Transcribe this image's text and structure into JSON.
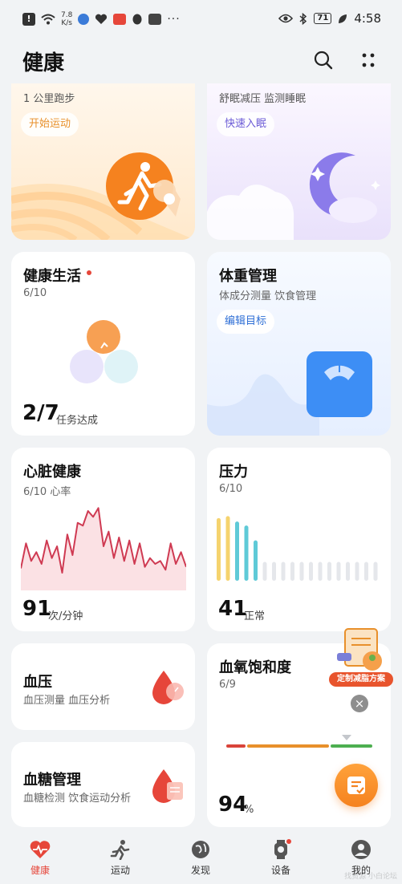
{
  "status_bar": {
    "net_speed_value": "7.8",
    "net_speed_unit": "K/s",
    "battery": "71",
    "time": "4:58"
  },
  "header": {
    "title": "健康"
  },
  "cards": {
    "run": {
      "subtitle": "1 公里跑步",
      "action": "开始运动"
    },
    "sleep": {
      "subtitle": "舒眠减压 监测睡眠",
      "action": "快速入眠"
    },
    "healthy_life": {
      "title": "健康生活",
      "sub": "6/10",
      "value": "2/7",
      "value_label": "任务达成"
    },
    "weight": {
      "title": "体重管理",
      "sub": "体成分测量 饮食管理",
      "action": "编辑目标"
    },
    "heart": {
      "title": "心脏健康",
      "sub": "6/10 心率",
      "value": "91",
      "unit": "次/分钟",
      "series": [
        55,
        72,
        60,
        66,
        58,
        74,
        62,
        70,
        52,
        78,
        64,
        86,
        84,
        94,
        90,
        96,
        70,
        80,
        62,
        76,
        60,
        74,
        58,
        72,
        56,
        62,
        58,
        60,
        54,
        72,
        58,
        66,
        56
      ]
    },
    "stress": {
      "title": "压力",
      "sub": "6/10",
      "value": "41",
      "unit": "正常",
      "levels": [
        0.93,
        0.96,
        0.88,
        0.82,
        0.6,
        0.28,
        0.28,
        0.28,
        0.28,
        0.28,
        0.28,
        0.28,
        0.28,
        0.28,
        0.28,
        0.28,
        0.28,
        0.28
      ],
      "colors": [
        "#f5d36e",
        "#f5d36e",
        "#5fcad7",
        "#5fcad7",
        "#5fcad7",
        "#e5e7eb",
        "#e5e7eb",
        "#e5e7eb",
        "#e5e7eb",
        "#e5e7eb",
        "#e5e7eb",
        "#e5e7eb",
        "#e5e7eb",
        "#e5e7eb",
        "#e5e7eb",
        "#e5e7eb",
        "#e5e7eb",
        "#e5e7eb"
      ]
    },
    "bp": {
      "title": "血压",
      "sub": "血压测量 血压分析"
    },
    "spo2": {
      "title": "血氧饱和度",
      "sub": "6/9",
      "value": "94",
      "unit": "%"
    },
    "glucose": {
      "title": "血糖管理",
      "sub": "血糖检测 饮食运动分析"
    }
  },
  "promo": {
    "label": "定制减脂方案"
  },
  "nav": {
    "items": [
      "健康",
      "运动",
      "发现",
      "设备",
      "我的"
    ],
    "active_color": "#e6463a"
  },
  "watermark": "找资源 小白论坛"
}
